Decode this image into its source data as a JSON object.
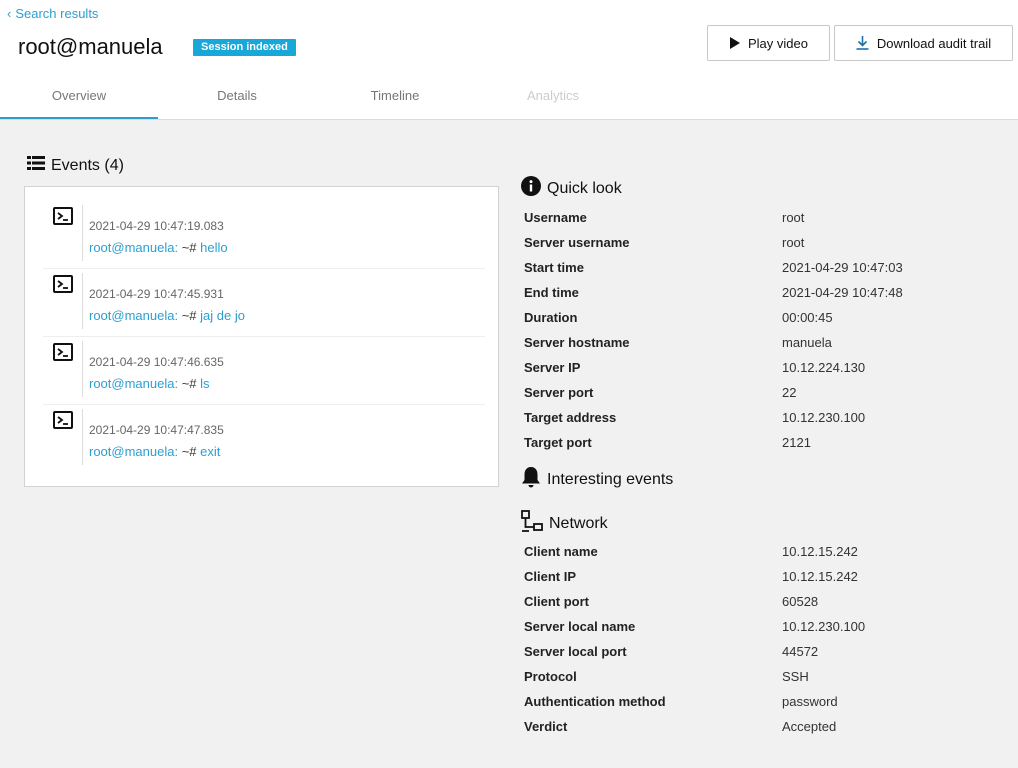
{
  "header": {
    "back_label": "Search results",
    "title": "root@manuela",
    "badge": "Session indexed",
    "play_label": "Play video",
    "download_label": "Download audit trail"
  },
  "tabs": [
    {
      "label": "Overview",
      "state": "active"
    },
    {
      "label": "Details",
      "state": "normal"
    },
    {
      "label": "Timeline",
      "state": "normal"
    },
    {
      "label": "Analytics",
      "state": "disabled"
    }
  ],
  "events": {
    "title": "Events (4)",
    "items": [
      {
        "timestamp": "2021-04-29 10:47:19.083",
        "prompt": "root@manuela:",
        "hash": " ~# ",
        "command": "hello"
      },
      {
        "timestamp": "2021-04-29 10:47:45.931",
        "prompt": "root@manuela:",
        "hash": " ~# ",
        "command": "jaj de jo"
      },
      {
        "timestamp": "2021-04-29 10:47:46.635",
        "prompt": "root@manuela:",
        "hash": " ~# ",
        "command": "ls"
      },
      {
        "timestamp": "2021-04-29 10:47:47.835",
        "prompt": "root@manuela:",
        "hash": " ~# ",
        "command": "exit"
      }
    ]
  },
  "quick_look": {
    "title": "Quick look",
    "rows": [
      {
        "key": "Username",
        "value": "root"
      },
      {
        "key": "Server username",
        "value": "root"
      },
      {
        "key": "Start time",
        "value": "2021-04-29 10:47:03"
      },
      {
        "key": "End time",
        "value": "2021-04-29 10:47:48"
      },
      {
        "key": "Duration",
        "value": "00:00:45"
      },
      {
        "key": "Server hostname",
        "value": "manuela"
      },
      {
        "key": "Server IP",
        "value": "10.12.224.130"
      },
      {
        "key": "Server port",
        "value": "22"
      },
      {
        "key": "Target address",
        "value": "10.12.230.100"
      },
      {
        "key": "Target port",
        "value": "2121"
      }
    ]
  },
  "interesting_events": {
    "title": "Interesting events"
  },
  "network": {
    "title": "Network",
    "rows": [
      {
        "key": "Client name",
        "value": "10.12.15.242"
      },
      {
        "key": "Client IP",
        "value": "10.12.15.242"
      },
      {
        "key": "Client port",
        "value": "60528"
      },
      {
        "key": "Server local name",
        "value": "10.12.230.100"
      },
      {
        "key": "Server local port",
        "value": "44572"
      },
      {
        "key": "Protocol",
        "value": "SSH"
      },
      {
        "key": "Authentication method",
        "value": "password"
      },
      {
        "key": "Verdict",
        "value": "Accepted"
      }
    ]
  },
  "icons": {
    "back": "chevron-left-icon",
    "play": "play-icon",
    "download": "download-icon",
    "events": "list-icon",
    "event": "terminal-icon",
    "quick_look": "info-icon",
    "interesting_events": "bell-icon",
    "network": "network-icon"
  },
  "colors": {
    "accent": "#2c9fd1",
    "badge": "#18a7d9",
    "background": "#f1f1f1"
  }
}
